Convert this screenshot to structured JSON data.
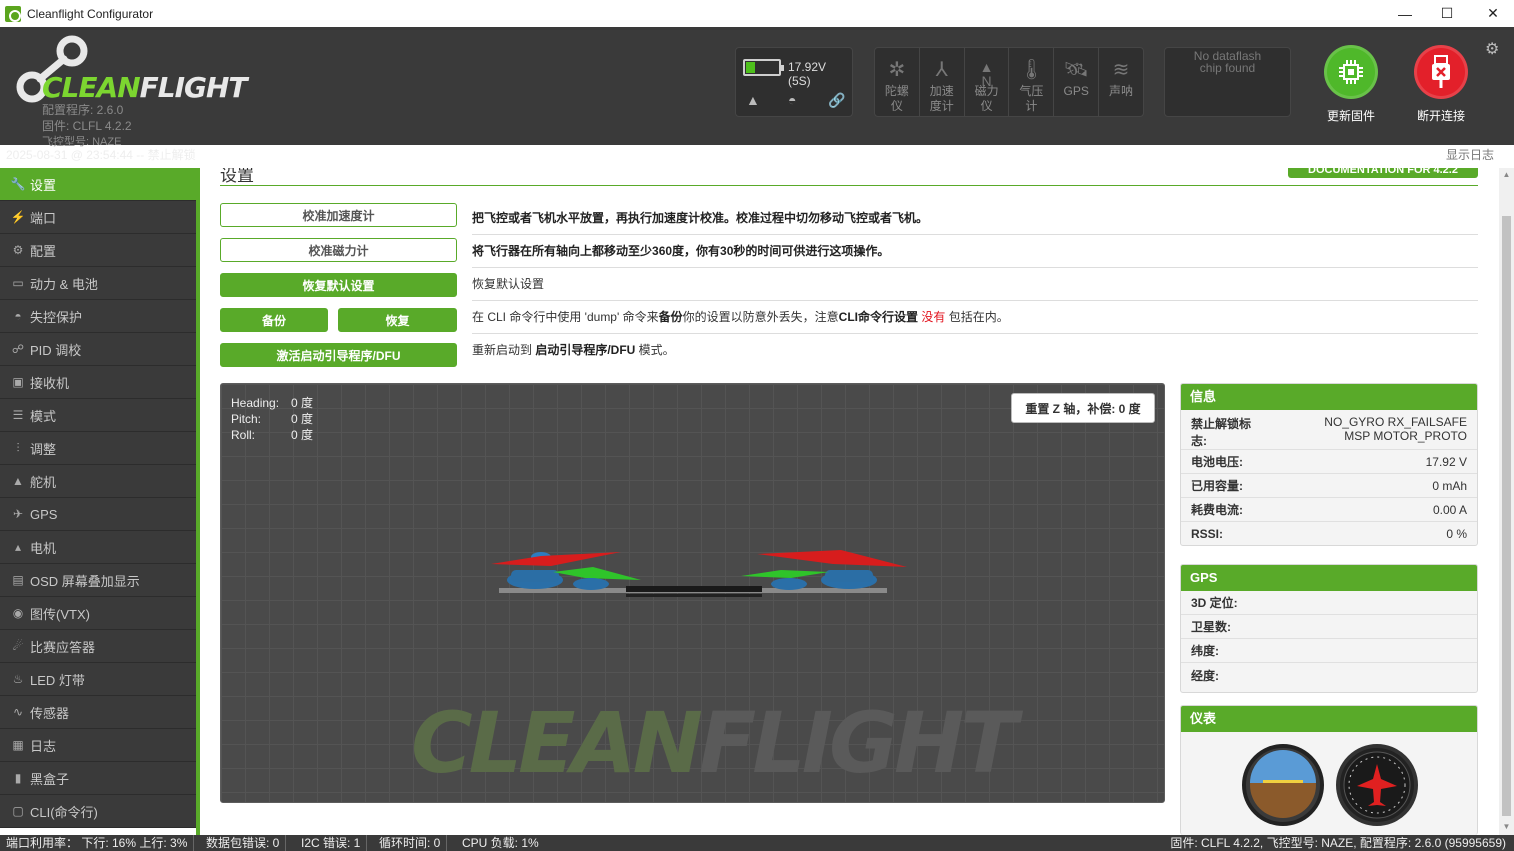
{
  "window": {
    "title": "Cleanflight Configurator"
  },
  "header": {
    "logo_text_a": "CLEAN",
    "logo_text_b": "FLIGHT",
    "config_version": "配置程序: 2.6.0",
    "firmware": "固件: CLFL 4.2.2",
    "board": "飞控型号: NAZE",
    "battery": {
      "voltage": "17.92V (5S)",
      "level_percent": 25
    },
    "sensors": [
      {
        "label": "陀螺仪",
        "icon": "gyro-icon"
      },
      {
        "label": "加速度计",
        "icon": "accel-icon"
      },
      {
        "label": "磁力仪",
        "icon": "mag-icon"
      },
      {
        "label": "气压计",
        "icon": "baro-icon"
      },
      {
        "label": "GPS",
        "icon": "gps-icon"
      },
      {
        "label": "声呐",
        "icon": "sonar-icon"
      }
    ],
    "dataflash": "No dataflash chip found",
    "flash_button": "更新固件",
    "disconnect_button": "断开连接",
    "status_left": "2025-08-31 @ 23:54:44 -- 禁止解锁",
    "show_log": "显示日志"
  },
  "sidebar": {
    "items": [
      {
        "label": "设置",
        "icon": "wrench-icon",
        "glyph": "🔧"
      },
      {
        "label": "端口",
        "icon": "plug-icon",
        "glyph": "⚡"
      },
      {
        "label": "配置",
        "icon": "gear-icon",
        "glyph": "⚙"
      },
      {
        "label": "动力 & 电池",
        "icon": "battery-icon",
        "glyph": "▭"
      },
      {
        "label": "失控保护",
        "icon": "parachute-icon",
        "glyph": "◓"
      },
      {
        "label": "PID 调校",
        "icon": "pid-icon",
        "glyph": "☍"
      },
      {
        "label": "接收机",
        "icon": "receiver-icon",
        "glyph": "▣"
      },
      {
        "label": "模式",
        "icon": "modes-icon",
        "glyph": "☰"
      },
      {
        "label": "调整",
        "icon": "adjust-icon",
        "glyph": "⫶"
      },
      {
        "label": "舵机",
        "icon": "servo-icon",
        "glyph": "▲"
      },
      {
        "label": "GPS",
        "icon": "satellite-icon",
        "glyph": "✈"
      },
      {
        "label": "电机",
        "icon": "motor-icon",
        "glyph": "▴"
      },
      {
        "label": "OSD 屏幕叠加显示",
        "icon": "osd-icon",
        "glyph": "▤"
      },
      {
        "label": "图传(VTX)",
        "icon": "vtx-icon",
        "glyph": "◉"
      },
      {
        "label": "比赛应答器",
        "icon": "transponder-icon",
        "glyph": "☄"
      },
      {
        "label": "LED 灯带",
        "icon": "led-icon",
        "glyph": "♨"
      },
      {
        "label": "传感器",
        "icon": "sensors-icon",
        "glyph": "∿"
      },
      {
        "label": "日志",
        "icon": "log-icon",
        "glyph": "▦"
      },
      {
        "label": "黑盒子",
        "icon": "blackbox-icon",
        "glyph": "▮"
      },
      {
        "label": "CLI(命令行)",
        "icon": "cli-icon",
        "glyph": "▢"
      }
    ]
  },
  "main": {
    "title": "设置",
    "doc_button": "DOCUMENTATION FOR 4.2.2",
    "actions": {
      "calib_acc": "校准加速度计",
      "calib_mag": "校准磁力计",
      "reset": "恢复默认设置",
      "backup": "备份",
      "restore": "恢复",
      "dfu": "激活启动引导程序/DFU"
    },
    "desc": {
      "acc": "把飞控或者飞机水平放置，再执行加速度计校准。校准过程中切勿移动飞控或者飞机。",
      "mag_a": "将飞行器在所有轴向上都移动至少",
      "mag_b": "360度",
      "mag_c": "，你有30秒的时间可供进行这项操作。",
      "reset": "恢复默认设置",
      "backup_a": "在 CLI 命令行中使用 'dump' 命令来",
      "backup_b": "备份",
      "backup_c": "你的设置以防意外丢失，注意",
      "backup_d": "CLI命令行设置",
      "backup_e": "没有",
      "backup_f": "包括在内。",
      "dfu_a": "重新启动到 ",
      "dfu_b": "启动引导程序/DFU",
      "dfu_c": " 模式。"
    },
    "attitude": {
      "heading_label": "Heading:",
      "heading": "0 度",
      "pitch_label": "Pitch:",
      "pitch": "0 度",
      "roll_label": "Roll:",
      "roll": "0 度"
    },
    "reset_z": "重置 Z 轴，补偿: 0 度"
  },
  "info": {
    "title": "信息",
    "arming_label": "禁止解锁标志:",
    "arming_value": "NO_GYRO RX_FAILSAFE MSP MOTOR_PROTO",
    "voltage_label": "电池电压:",
    "voltage": "17.92 V",
    "capacity_label": "已用容量:",
    "capacity": "0 mAh",
    "current_label": "耗费电流:",
    "current": "0.00 A",
    "rssi_label": "RSSI:",
    "rssi": "0 %"
  },
  "gps": {
    "title": "GPS",
    "fix_label": "3D 定位:",
    "sats_label": "卫星数:",
    "lat_label": "纬度:",
    "lon_label": "经度:"
  },
  "instruments": {
    "title": "仪表"
  },
  "footer": {
    "port_util": "端口利用率：  下行: 16% 上行: 3%",
    "packet_err": "数据包错误: 0",
    "i2c_err": "I2C 错误: 1",
    "cycle": "循环时间: 0",
    "cpu": "CPU 负载: 1%",
    "right": "固件: CLFL 4.2.2, 飞控型号: NAZE, 配置程序: 2.6.0 (95995659)"
  },
  "colors": {
    "accent": "#59aa29",
    "header_bg": "#3a3a3a",
    "flash_btn": "#4fb82a",
    "disconnect_btn": "#e3202a"
  }
}
